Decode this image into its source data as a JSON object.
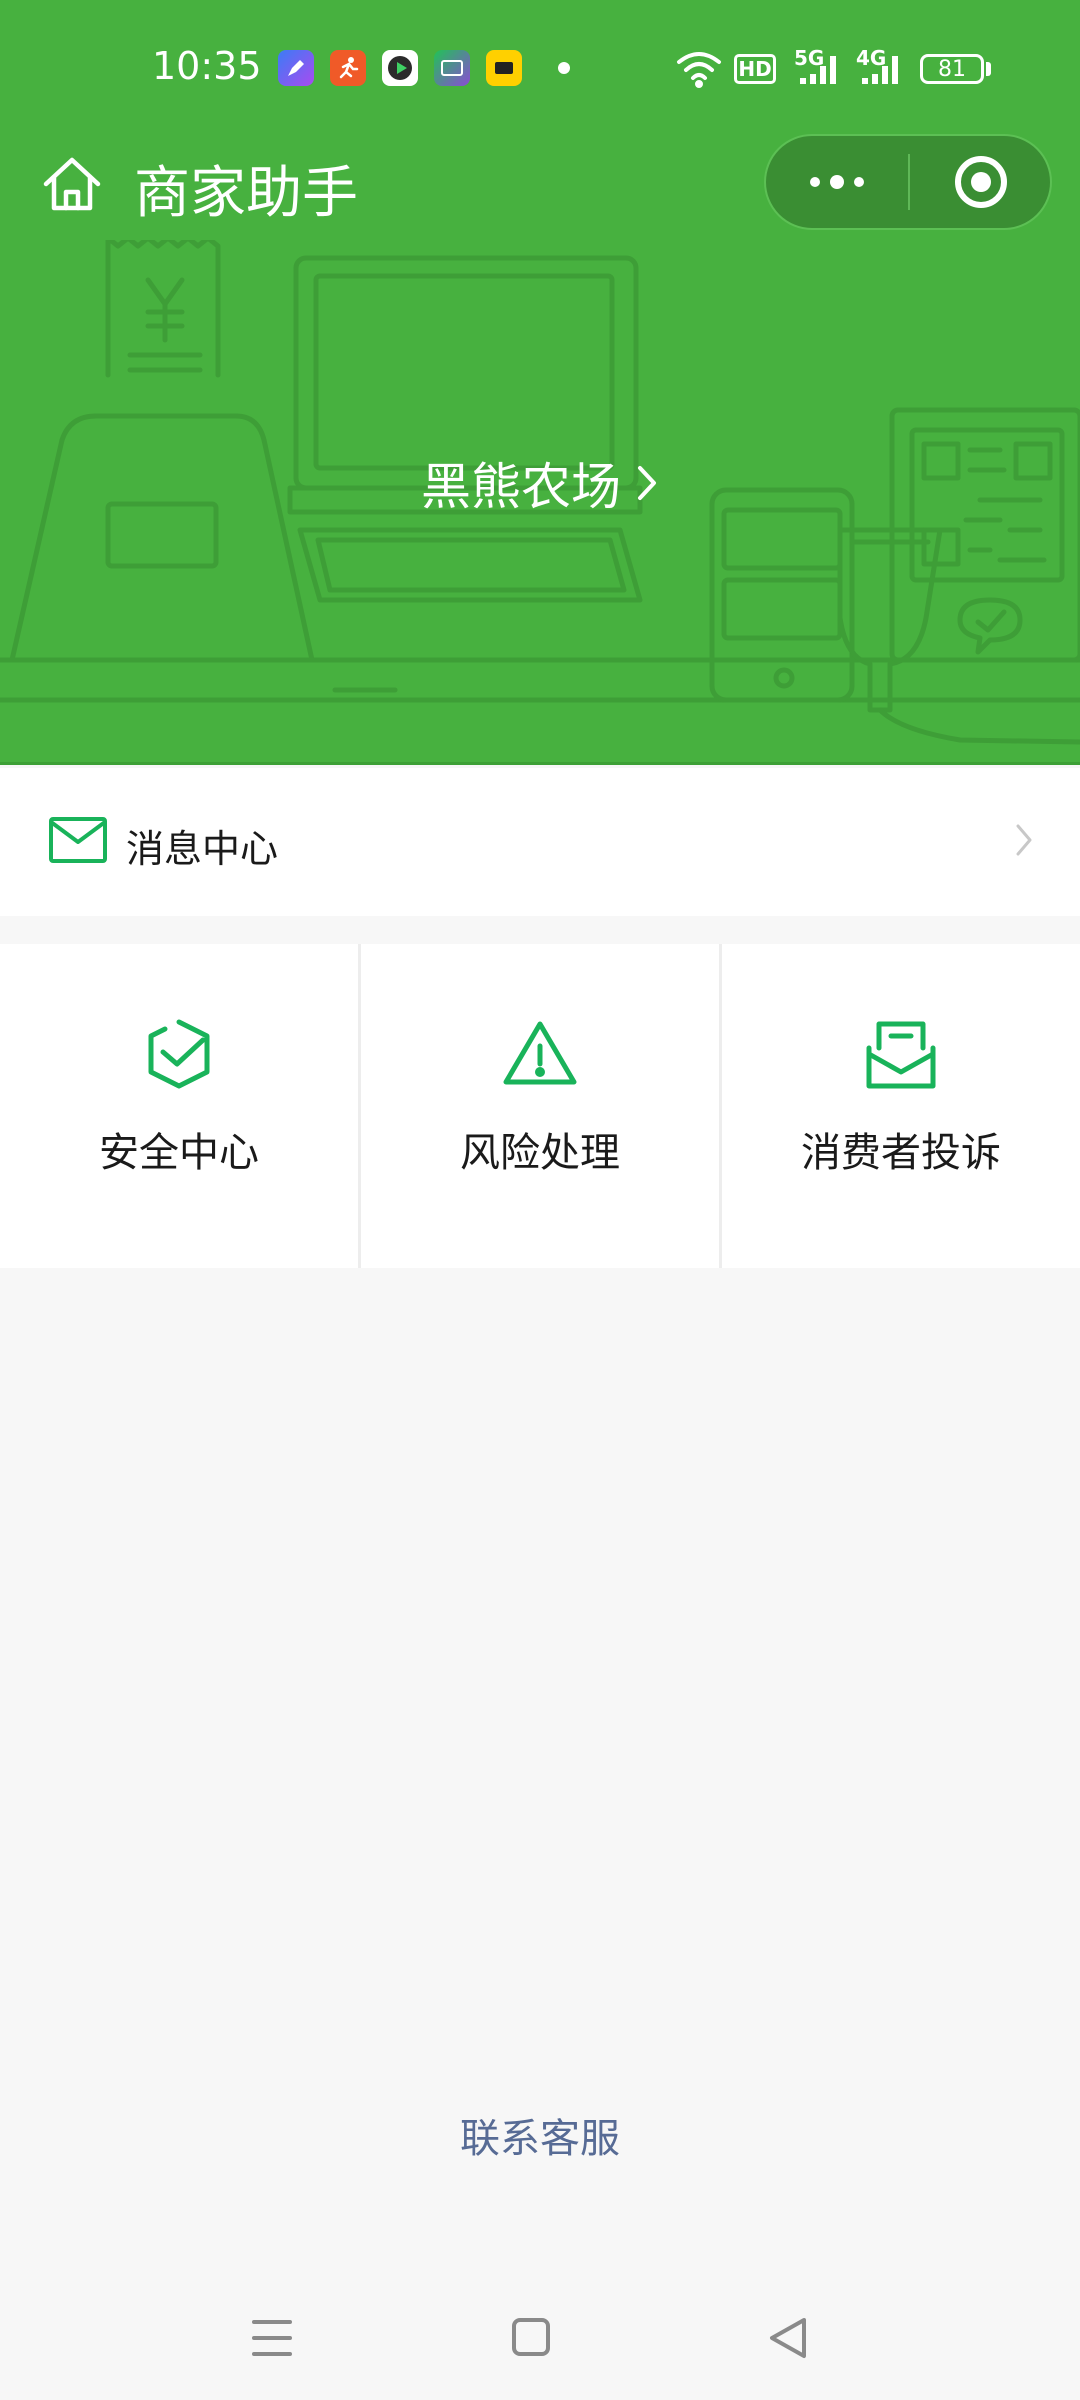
{
  "status_bar": {
    "time": "10:35",
    "app_icons": [
      {
        "name": "pen-app-icon",
        "color": "#3b7cf5"
      },
      {
        "name": "running-app-icon",
        "color": "#f05a28"
      },
      {
        "name": "video-play-app-icon",
        "color": "#2b2b2b"
      },
      {
        "name": "iqiyi-app-icon",
        "color": "#21c356"
      },
      {
        "name": "meituan-app-icon",
        "color": "#ffd000"
      }
    ],
    "hd_label": "HD",
    "net_5g": "5G",
    "net_4g": "4G",
    "battery": "81"
  },
  "nav": {
    "title": "商家助手"
  },
  "header": {
    "store_name": "黑熊农场",
    "background_color": "#47b13f"
  },
  "message_center": {
    "label": "消息中心"
  },
  "grid": [
    {
      "label": "安全中心",
      "icon": "shield-check-icon"
    },
    {
      "label": "风险处理",
      "icon": "warning-triangle-icon"
    },
    {
      "label": "消费者投诉",
      "icon": "complaint-envelope-icon"
    }
  ],
  "footer": {
    "contact_label": "联系客服"
  },
  "colors": {
    "brand_green": "#47b13f",
    "icon_green": "#19b35a",
    "link_blue": "#576b95"
  }
}
